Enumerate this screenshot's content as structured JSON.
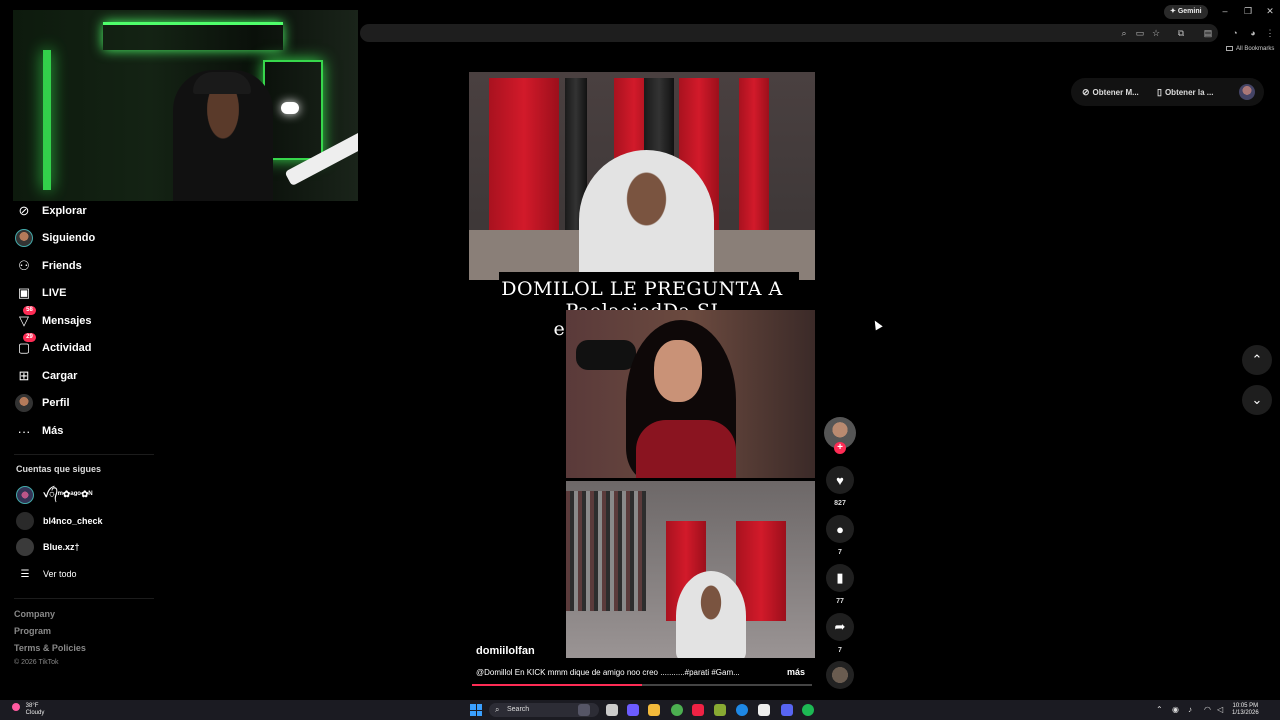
{
  "browser": {
    "gemini_label": "Gemini",
    "bookmarks_label": "All Bookmarks"
  },
  "sidebar": {
    "items": [
      {
        "label": "Explorar",
        "icon": "compass-icon"
      },
      {
        "label": "Siguiendo",
        "icon": "avatar-icon"
      },
      {
        "label": "Friends",
        "icon": "friends-icon"
      },
      {
        "label": "LIVE",
        "icon": "live-icon"
      },
      {
        "label": "Mensajes",
        "icon": "messages-icon",
        "badge": "58"
      },
      {
        "label": "Actividad",
        "icon": "activity-icon",
        "badge": "29"
      },
      {
        "label": "Cargar",
        "icon": "upload-icon"
      },
      {
        "label": "Perfil",
        "icon": "profile-icon"
      },
      {
        "label": "Más",
        "icon": "more-icon"
      }
    ],
    "following_title": "Cuentas que sigues",
    "following": [
      {
        "name": "ꪜ᭄ᵐ✿ᵃᵍᵒ✿ᴺ"
      },
      {
        "name": "bl4nco_check"
      },
      {
        "name": "Blue.xz†"
      },
      {
        "name": "Ver todo"
      }
    ],
    "footer": {
      "company": "Company",
      "program": "Program",
      "terms": "Terms & Policies",
      "copyright": "© 2026 TikTok"
    }
  },
  "video": {
    "caption_line1": "DOMILOL LE PREGUNTA A PaolaojedDa SI",
    "caption_line2": "estaría con rdjavi",
    "author": "domiilolfan",
    "description": "@Domillol En KICK mmm dique de amigo noo creo ...........#parati #Gam...",
    "more_label": "más",
    "progress": 0.5
  },
  "actions": {
    "likes": "827",
    "comments": "7",
    "saves": "77",
    "shares": "7"
  },
  "extensions": {
    "btn1": "Obtener M...",
    "btn2": "Obtener la ..."
  },
  "taskbar": {
    "temp": "38°F",
    "weather": "Cloudy",
    "search": "Search",
    "time": "10:05 PM",
    "date": "1/13/2026"
  },
  "colors": {
    "accent": "#fe2c55",
    "neon": "#4fff6b"
  }
}
